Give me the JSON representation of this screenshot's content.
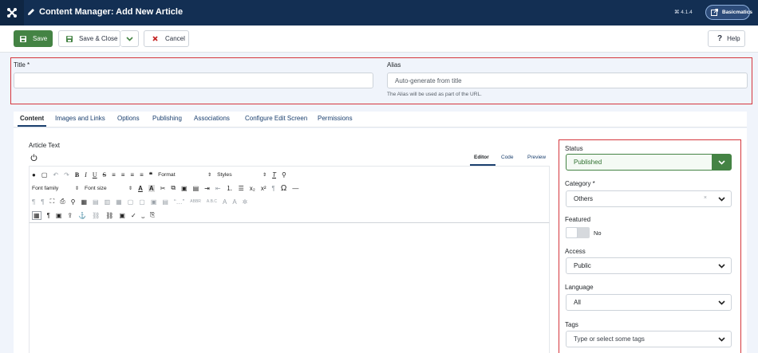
{
  "header": {
    "title": "Content Manager: Add New Article",
    "version": "⌘ 4.1.4",
    "site_button": "Basicmatics"
  },
  "toolbar": {
    "save": "Save",
    "save_close": "Save & Close",
    "cancel": "Cancel",
    "help": "Help"
  },
  "fields": {
    "title_label": "Title *",
    "title_value": "",
    "alias_label": "Alias",
    "alias_placeholder": "Auto-generate from title",
    "alias_hint": "The Alias will be used as part of the URL."
  },
  "tabs": [
    "Content",
    "Images and Links",
    "Options",
    "Publishing",
    "Associations",
    "Configure Edit Screen",
    "Permissions"
  ],
  "editor": {
    "label": "Article Text",
    "tabs": [
      "Editor",
      "Code",
      "Preview"
    ],
    "format_select": "Format",
    "styles_select": "Styles",
    "font_family_select": "Font family",
    "font_size_select": "Font size"
  },
  "sidebar": {
    "status_label": "Status",
    "status_value": "Published",
    "category_label": "Category *",
    "category_value": "Others",
    "featured_label": "Featured",
    "featured_value": "No",
    "access_label": "Access",
    "access_value": "Public",
    "language_label": "Language",
    "language_value": "All",
    "tags_label": "Tags",
    "tags_placeholder": "Type or select some tags"
  },
  "colors": {
    "header_bg": "#132f53",
    "save_green": "#448344",
    "cancel_red": "#c52827",
    "highlight_red": "#d5363c"
  }
}
